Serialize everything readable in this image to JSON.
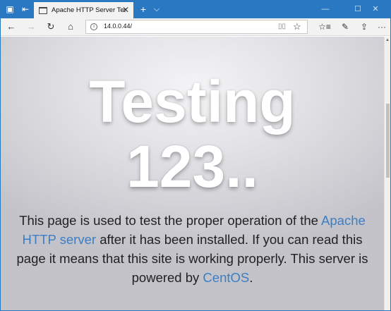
{
  "browser": {
    "tab_title": "Apache HTTP Server Test Page powered by CentOS",
    "tab_close": "✕",
    "new_tab": "+",
    "tab_menu": "⌵",
    "minimize": "—",
    "maximize": "☐",
    "close": "✕"
  },
  "navbar": {
    "back": "←",
    "forward": "→",
    "refresh": "↻",
    "home": "⌂",
    "url": "14.0.0.44/",
    "info": "i",
    "reading_view": "📖",
    "favorite": "☆",
    "favorites_bar": "☆≡",
    "notes": "✎",
    "share": "⇪",
    "more": "···"
  },
  "page": {
    "heading_line1": "Testing",
    "heading_line2": "123..",
    "desc_part1": "This page is used to test the proper operation of the",
    "desc_link1": "Apache HTTP server",
    "desc_part2": "after it has been installed. If you can read this page it means that this site is working properly. This server is powered by",
    "desc_link2": "CentOS",
    "desc_end": "."
  },
  "colors": {
    "titlebar": "#2b78c2",
    "link": "#3a7fc5"
  }
}
